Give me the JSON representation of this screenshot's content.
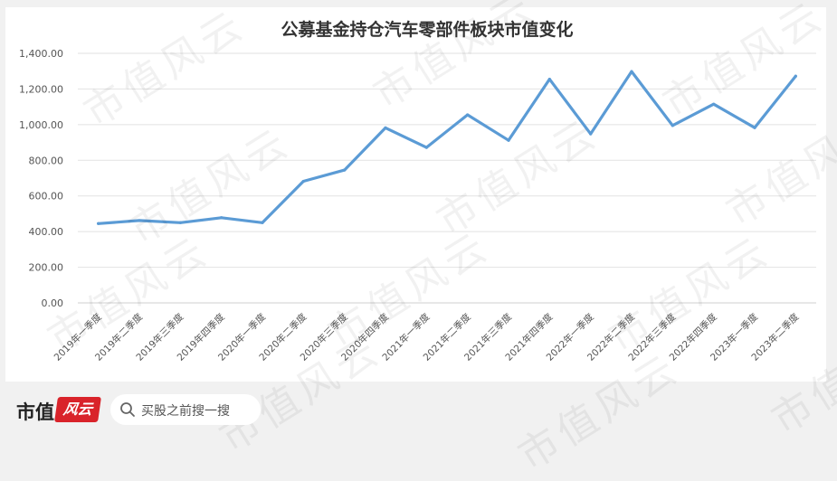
{
  "chart_data": {
    "type": "line",
    "title": "公募基金持仓汽车零部件板块市值变化",
    "categories": [
      "2019年一季度",
      "2019年二季度",
      "2019年三季度",
      "2019年四季度",
      "2020年一季度",
      "2020年二季度",
      "2020年三季度",
      "2020年四季度",
      "2021年一季度",
      "2021年二季度",
      "2021年三季度",
      "2021年四季度",
      "2022年一季度",
      "2022年二季度",
      "2022年三季度",
      "2022年四季度",
      "2023年一季度",
      "2023年二季度"
    ],
    "series": [
      {
        "values": [
          445,
          462,
          450,
          478,
          450,
          682,
          745,
          982,
          872,
          1055,
          912,
          1255,
          948,
          1298,
          995,
          1115,
          983,
          1272
        ]
      }
    ],
    "yticks": [
      "0.00",
      "200.00",
      "400.00",
      "600.00",
      "800.00",
      "1,000.00",
      "1,200.00",
      "1,400.00"
    ],
    "ylim": [
      0,
      1400
    ],
    "grid": true,
    "colors": {
      "line": "#5b9bd5"
    }
  },
  "watermark": {
    "text": "市值风云"
  },
  "footer": {
    "brand_text": "市值",
    "brand_logo_text": "风云",
    "search_placeholder": "买股之前搜一搜",
    "icon": "search-icon"
  }
}
